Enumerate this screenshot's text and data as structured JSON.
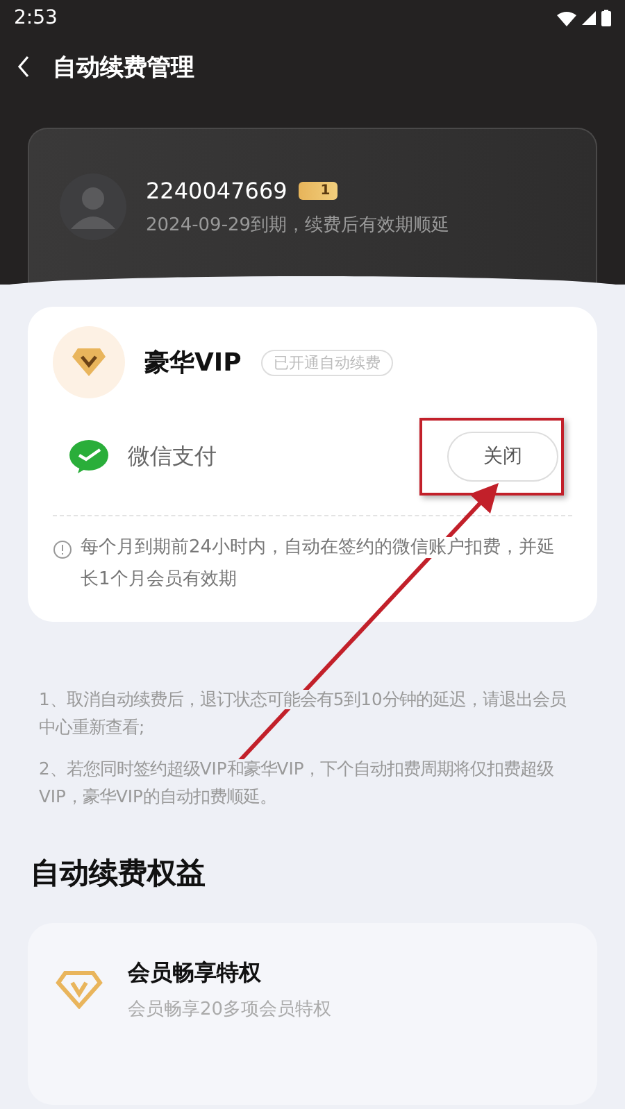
{
  "status_bar": {
    "time": "2:53"
  },
  "header": {
    "title": "自动续费管理"
  },
  "user": {
    "id": "2240047669",
    "level": "1",
    "expiry": "2024-09-29到期，续费后有效期顺延"
  },
  "subscription": {
    "name": "豪华VIP",
    "badge": "已开通自动续费",
    "payment": "微信支付",
    "close_button": {
      "label": "关闭",
      "highlighted": true
    },
    "note": "每个月到期前24小时内，自动在签约的微信账户扣费，并延长1个月会员有效期"
  },
  "notes": [
    "1、取消自动续费后，退订状态可能会有5到10分钟的延迟，请退出会员中心重新查看;",
    "2、若您同时签约超级VIP和豪华VIP，下个自动扣费周期将仅扣费超级VIP，豪华VIP的自动扣费顺延。"
  ],
  "benefits": {
    "title": "自动续费权益",
    "items": [
      {
        "title": "会员畅享特权",
        "subtitle": "会员畅享20多项会员特权"
      }
    ]
  }
}
